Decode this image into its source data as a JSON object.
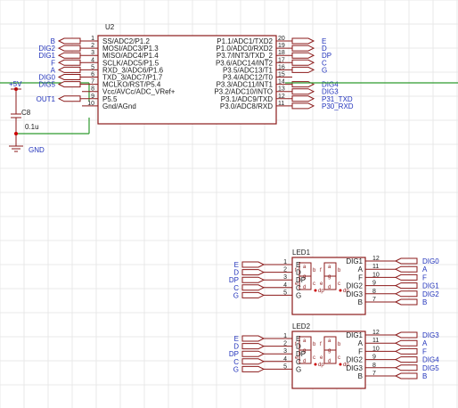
{
  "u2": {
    "ref": "U2",
    "left_pins": [
      {
        "num": "1",
        "name": "SS/ADC2/P1.2",
        "net": "B"
      },
      {
        "num": "2",
        "name": "MOSI/ADC3/P1.3",
        "net": "DIG2"
      },
      {
        "num": "3",
        "name": "MISO/ADC4/P1.4",
        "net": "DIG1"
      },
      {
        "num": "4",
        "name": "SCLK/ADC5/P1.5",
        "net": "F"
      },
      {
        "num": "5",
        "name": "RXD_3/ADC6/P1.6",
        "net": "A"
      },
      {
        "num": "6",
        "name": "TXD_3/ADC7/P1.7",
        "net": "DIG0"
      },
      {
        "num": "7",
        "name": "MCLKO/RST/P5.4",
        "net": "DIG5"
      },
      {
        "num": "8",
        "name": "Vcc/AVCc/ADC_VRef+",
        "net": ""
      },
      {
        "num": "9",
        "name": "P5.5",
        "net": "OUT1"
      },
      {
        "num": "10",
        "name": "Gnd/AGnd",
        "net": ""
      }
    ],
    "right_pins": [
      {
        "num": "20",
        "name": "P1.1/ADC1/TXD2",
        "net": "E"
      },
      {
        "num": "19",
        "name": "P1.0/ADC0/RXD2",
        "net": "D"
      },
      {
        "num": "18",
        "name": "P3.7/INT3/TXD_2",
        "net": "DP"
      },
      {
        "num": "17",
        "name": "P3.6/ADC14/INT2",
        "net": "C"
      },
      {
        "num": "16",
        "name": "P3.5/ADC13/T1",
        "net": "G"
      },
      {
        "num": "15",
        "name": "P3.4/ADC12/T0",
        "net": ""
      },
      {
        "num": "14",
        "name": "P3.3/ADC11/INT1",
        "net": "DIG4"
      },
      {
        "num": "13",
        "name": "P3.2/ADC10/INTO",
        "net": "DIG3"
      },
      {
        "num": "12",
        "name": "P3.1/ADC9/TXD",
        "net": "P31_TXD"
      },
      {
        "num": "11",
        "name": "P3.0/ADC8/RXD",
        "net": "P30_RXD"
      }
    ]
  },
  "power": {
    "vcc_label": "+5V",
    "gnd_label": "GND",
    "cap_ref": "C8",
    "cap_value": "0.1u"
  },
  "leds": [
    {
      "ref": "LED1",
      "left_pins": [
        {
          "num": "1",
          "name": "E",
          "net": "E"
        },
        {
          "num": "2",
          "name": "D",
          "net": "D"
        },
        {
          "num": "3",
          "name": "DP",
          "net": "DP"
        },
        {
          "num": "4",
          "name": "C",
          "net": "C"
        },
        {
          "num": "5",
          "name": "G",
          "net": "G"
        }
      ],
      "right_pins": [
        {
          "num": "12",
          "name": "DIG1",
          "net": "DIG0"
        },
        {
          "num": "11",
          "name": "A",
          "net": "A"
        },
        {
          "num": "10",
          "name": "F",
          "net": "F"
        },
        {
          "num": "9",
          "name": "DIG2",
          "net": "DIG1"
        },
        {
          "num": "8",
          "name": "DIG3",
          "net": "DIG2"
        },
        {
          "num": "7",
          "name": "B",
          "net": "B"
        }
      ]
    },
    {
      "ref": "LED2",
      "left_pins": [
        {
          "num": "1",
          "name": "E",
          "net": "E"
        },
        {
          "num": "2",
          "name": "D",
          "net": "D"
        },
        {
          "num": "3",
          "name": "DP",
          "net": "DP"
        },
        {
          "num": "4",
          "name": "C",
          "net": "C"
        },
        {
          "num": "5",
          "name": "G",
          "net": "G"
        }
      ],
      "right_pins": [
        {
          "num": "12",
          "name": "DIG1",
          "net": "DIG3"
        },
        {
          "num": "11",
          "name": "A",
          "net": "A"
        },
        {
          "num": "10",
          "name": "F",
          "net": "F"
        },
        {
          "num": "9",
          "name": "DIG2",
          "net": "DIG4"
        },
        {
          "num": "8",
          "name": "DIG3",
          "net": "DIG5"
        },
        {
          "num": "7",
          "name": "B",
          "net": "B"
        }
      ]
    }
  ],
  "segment_labels": {
    "a": "a",
    "b": "b",
    "c": "c",
    "d": "d",
    "e": "e",
    "f": "f",
    "g": "g",
    "dp": "dp"
  },
  "colors": {
    "body": "#8b1a1a",
    "wire": "#2e9a2e",
    "net": "#2233bb",
    "dot": "#cc0000"
  }
}
